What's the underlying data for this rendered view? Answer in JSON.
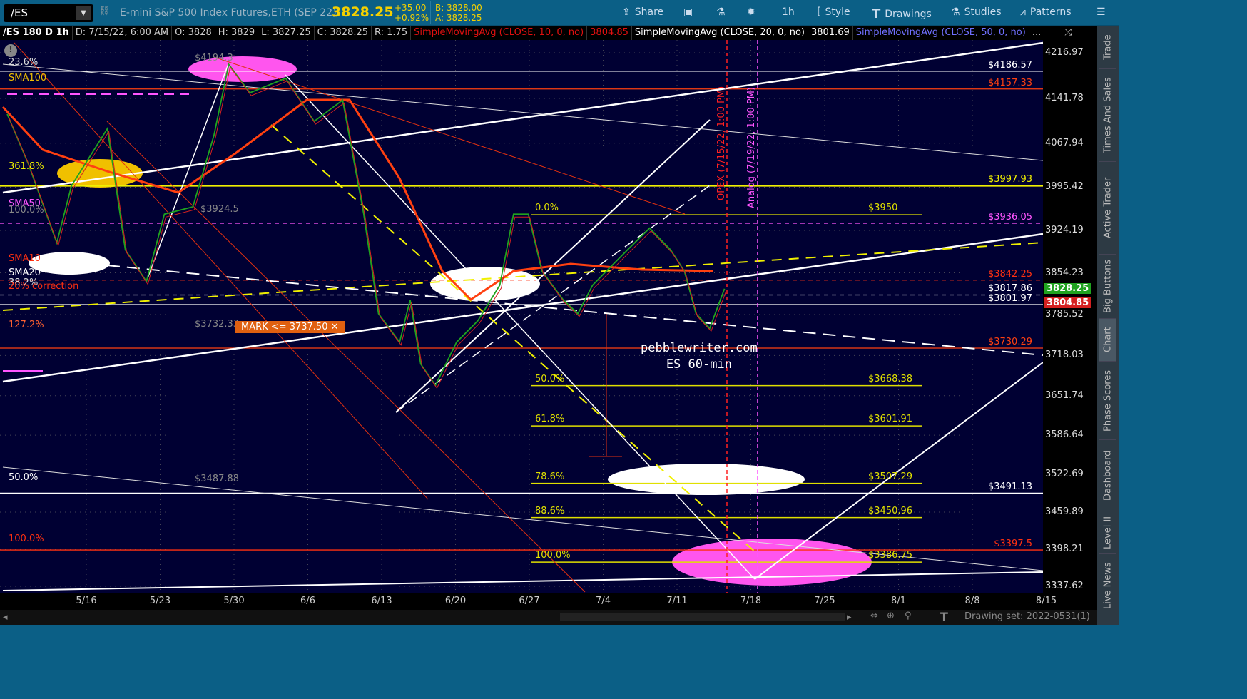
{
  "topbar": {
    "symbol": "/ES",
    "description": "E-mini S&P 500 Index Futures,ETH (SEP 22)",
    "last": "3828.25",
    "change": "+35.00",
    "change_pct": "+0.92%",
    "bid": "B: 3828.00",
    "ask": "A: 3828.25",
    "buttons": [
      {
        "label": "Share",
        "icon": "share-icon"
      },
      {
        "label": "",
        "icon": "notes-icon"
      },
      {
        "label": "",
        "icon": "flask-icon"
      },
      {
        "label": "",
        "icon": "gear-icon"
      },
      {
        "label": "1h",
        "icon": ""
      },
      {
        "label": "Style",
        "icon": "candle-icon"
      },
      {
        "label": "Drawings",
        "icon": "text-icon"
      },
      {
        "label": "Studies",
        "icon": "flask-icon"
      },
      {
        "label": "Patterns",
        "icon": "patterns-icon"
      },
      {
        "label": "",
        "icon": "menu-icon"
      }
    ]
  },
  "legend": {
    "title": "/ES 180 D 1h",
    "date": "D: 7/15/22, 6:00 AM",
    "open": "O: 3828",
    "high": "H: 3829",
    "low": "L: 3827.25",
    "close": "C: 3828.25",
    "range": "R: 1.75",
    "sma10": "SimpleMovingAvg (CLOSE, 10, 0, no)",
    "sma10_val": "3804.85",
    "sma20": "SimpleMovingAvg (CLOSE, 20, 0, no)",
    "sma20_val": "3801.69",
    "sma50": "SimpleMovingAvg (CLOSE, 50, 0, no)",
    "more": "..."
  },
  "price_axis": {
    "ticks": [
      "4216.97",
      "4141.78",
      "4067.94",
      "3995.42",
      "3924.19",
      "3854.23",
      "3785.52",
      "3718.03",
      "3651.74",
      "3586.64",
      "3522.69",
      "3459.89",
      "3398.21",
      "3337.62"
    ],
    "last_badge": "3828.25",
    "sma_badge": "3804.85",
    "colors": {
      "up": "#1fa31f",
      "down": "#d42020"
    }
  },
  "levels": [
    {
      "price": 4186.57,
      "label": "$4186.57",
      "color": "#ffffff",
      "dash": false
    },
    {
      "price": 4157.33,
      "label": "$4157.33",
      "color": "#ff4010",
      "dash": false
    },
    {
      "price": 3997.93,
      "label": "$3997.93",
      "color": "#f0f000",
      "dash": false
    },
    {
      "price": 3936.05,
      "label": "$3936.05",
      "color": "#ff55ff",
      "dash": true
    },
    {
      "price": 3842.25,
      "label": "$3842.25",
      "color": "#ff3010",
      "dash": true
    },
    {
      "price": 3817.86,
      "label": "$3817.86",
      "color": "#ffffff",
      "dash": true
    },
    {
      "price": 3801.97,
      "label": "$3801.97",
      "color": "#ffffff",
      "dash": false
    },
    {
      "price": 3730.29,
      "label": "$3730.29",
      "color": "#ff4010",
      "dash": false
    },
    {
      "price": 3491.13,
      "label": "$3491.13",
      "color": "#ffffff",
      "dash": false
    },
    {
      "price": 3397.5,
      "label": "$3397.5",
      "color": "#ff3010",
      "dash": false
    }
  ],
  "fib": [
    {
      "pct": "0.0%",
      "label": "$3950",
      "price": 3950
    },
    {
      "pct": "50.0%",
      "label": "$3668.38",
      "price": 3668.38
    },
    {
      "pct": "61.8%",
      "label": "$3601.91",
      "price": 3601.91
    },
    {
      "pct": "78.6%",
      "label": "$3507.29",
      "price": 3507.29
    },
    {
      "pct": "88.6%",
      "label": "$3450.96",
      "price": 3450.96
    },
    {
      "pct": "100.0%",
      "label": "$3386.75",
      "price": 3386.75
    }
  ],
  "left_labels": {
    "l1": "23.6%",
    "l2": "SMA100",
    "l3": "361.8%",
    "l4": "SMA50",
    "l5": "100.0%",
    "l6": "SMA10",
    "l7": "SMA20",
    "l8": "38.2%",
    "l9": "20% correction",
    "l10": "127.2%",
    "l11": "50.0%",
    "l12": "100.0%",
    "g1": "$4194.3",
    "g2": "$3924.5",
    "g3": "$3732.33",
    "g4": "$3487.88"
  },
  "mark": "MARK <= 3737.50 ✕",
  "verticals": {
    "opex": "OPEX (7/15/22, 1:00 PM)",
    "analog": "Analog (7/19/22, 1:00 PM)"
  },
  "watermark": {
    "line1": "pebblewriter.com",
    "line2": "ES 60-min"
  },
  "x_axis": [
    "5/16",
    "5/23",
    "5/30",
    "6/6",
    "6/13",
    "6/20",
    "6/27",
    "7/4",
    "7/11",
    "7/18",
    "7/25",
    "8/1",
    "8/8",
    "8/15"
  ],
  "drawing_set": "Drawing set: 2022-0531(1)",
  "side_tabs": [
    "Trade",
    "Times And Sales",
    "Active Trader",
    "Big Buttons",
    "Chart",
    "Phase Scores",
    "Dashboard",
    "Level II",
    "Live News"
  ],
  "chart_data": {
    "type": "line",
    "x_unit": "days since 5/16",
    "price_path": [
      [
        -7.5,
        4116
      ],
      [
        -5.5,
        4034
      ],
      [
        -2.8,
        3904
      ],
      [
        -1.4,
        3998
      ],
      [
        2.0,
        4092
      ],
      [
        3.7,
        3892
      ],
      [
        5.7,
        3840
      ],
      [
        7.4,
        3951
      ],
      [
        10.1,
        3963
      ],
      [
        12.1,
        4081
      ],
      [
        13.5,
        4198
      ],
      [
        15.5,
        4151
      ],
      [
        18.9,
        4175
      ],
      [
        21.6,
        4104
      ],
      [
        24.3,
        4139
      ],
      [
        26.3,
        3951
      ],
      [
        27.7,
        3787
      ],
      [
        29.7,
        3740
      ],
      [
        30.7,
        3810
      ],
      [
        31.7,
        3704
      ],
      [
        33.1,
        3669
      ],
      [
        35.1,
        3740
      ],
      [
        37.1,
        3775
      ],
      [
        39.2,
        3834
      ],
      [
        40.5,
        3951
      ],
      [
        41.9,
        3951
      ],
      [
        43.2,
        3857
      ],
      [
        45.2,
        3810
      ],
      [
        46.6,
        3787
      ],
      [
        48,
        3834
      ],
      [
        49.3,
        3857
      ],
      [
        51.3,
        3892
      ],
      [
        53.4,
        3928
      ],
      [
        55.4,
        3892
      ],
      [
        56.7,
        3857
      ],
      [
        57.8,
        3787
      ],
      [
        59.1,
        3763
      ],
      [
        60.5,
        3828
      ]
    ]
  }
}
